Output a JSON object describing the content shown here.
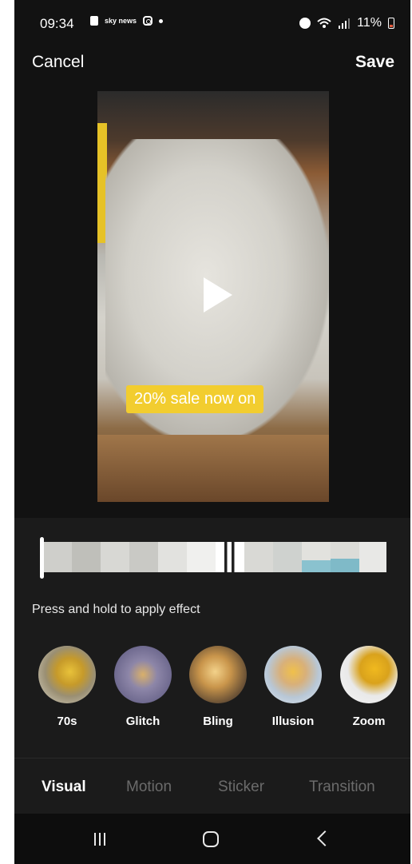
{
  "status_bar": {
    "time": "09:34",
    "left_icons": [
      "lock-icon",
      "sky-news-icon",
      "instagram-icon",
      "dot-icon"
    ],
    "sky_label": "sky news",
    "battery": "11%"
  },
  "header": {
    "cancel_label": "Cancel",
    "save_label": "Save"
  },
  "preview": {
    "caption": "20% sale now on",
    "caption_color": "#f2cd2f"
  },
  "panel": {
    "hint": "Press and hold to apply effect",
    "effects": [
      {
        "label": "70s"
      },
      {
        "label": "Glitch"
      },
      {
        "label": "Bling"
      },
      {
        "label": "Illusion"
      },
      {
        "label": "Zoom"
      }
    ],
    "tabs": [
      {
        "label": "Visual",
        "active": true
      },
      {
        "label": "Motion",
        "active": false
      },
      {
        "label": "Sticker",
        "active": false
      },
      {
        "label": "Transition",
        "active": false
      }
    ]
  },
  "colors": {
    "background": "#121212",
    "panel": "#1b1b1b",
    "accent_yellow": "#f2cd2f"
  }
}
